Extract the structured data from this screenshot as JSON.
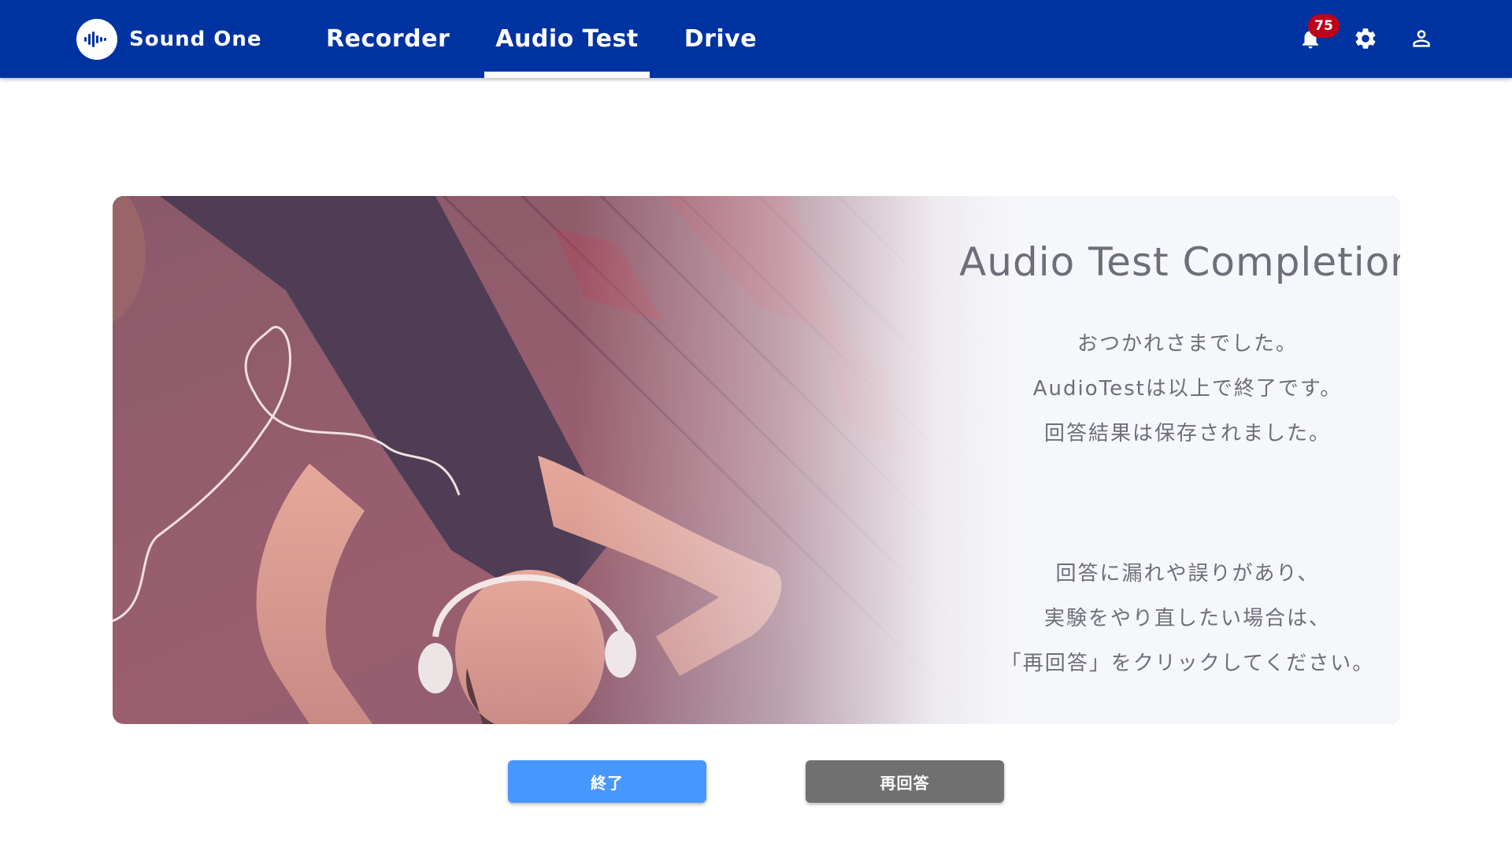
{
  "app": {
    "name": "Sound One",
    "logo_icon": "waveform-icon",
    "brand_color": "#0033a2"
  },
  "nav": {
    "tabs": [
      {
        "label": "Recorder",
        "active": false
      },
      {
        "label": "Audio Test",
        "active": true
      },
      {
        "label": "Drive",
        "active": false
      }
    ]
  },
  "header_icons": {
    "notifications": {
      "icon": "bell-icon",
      "count": "75"
    },
    "settings": {
      "icon": "gear-icon"
    },
    "account": {
      "icon": "person-icon"
    }
  },
  "card": {
    "title": "Audio Test Completion",
    "message_lines": [
      "おつかれさまでした。",
      "AudioTestは以上で終了です。",
      "回答結果は保存されました。"
    ],
    "retry_lines": [
      "回答に漏れや誤りがあり、",
      "実験をやり直したい場合は、",
      "「再回答」をクリックしてください。"
    ]
  },
  "buttons": {
    "finish": {
      "label": "終了",
      "color": "#4897ff"
    },
    "retry": {
      "label": "再回答",
      "color": "#707070"
    }
  }
}
